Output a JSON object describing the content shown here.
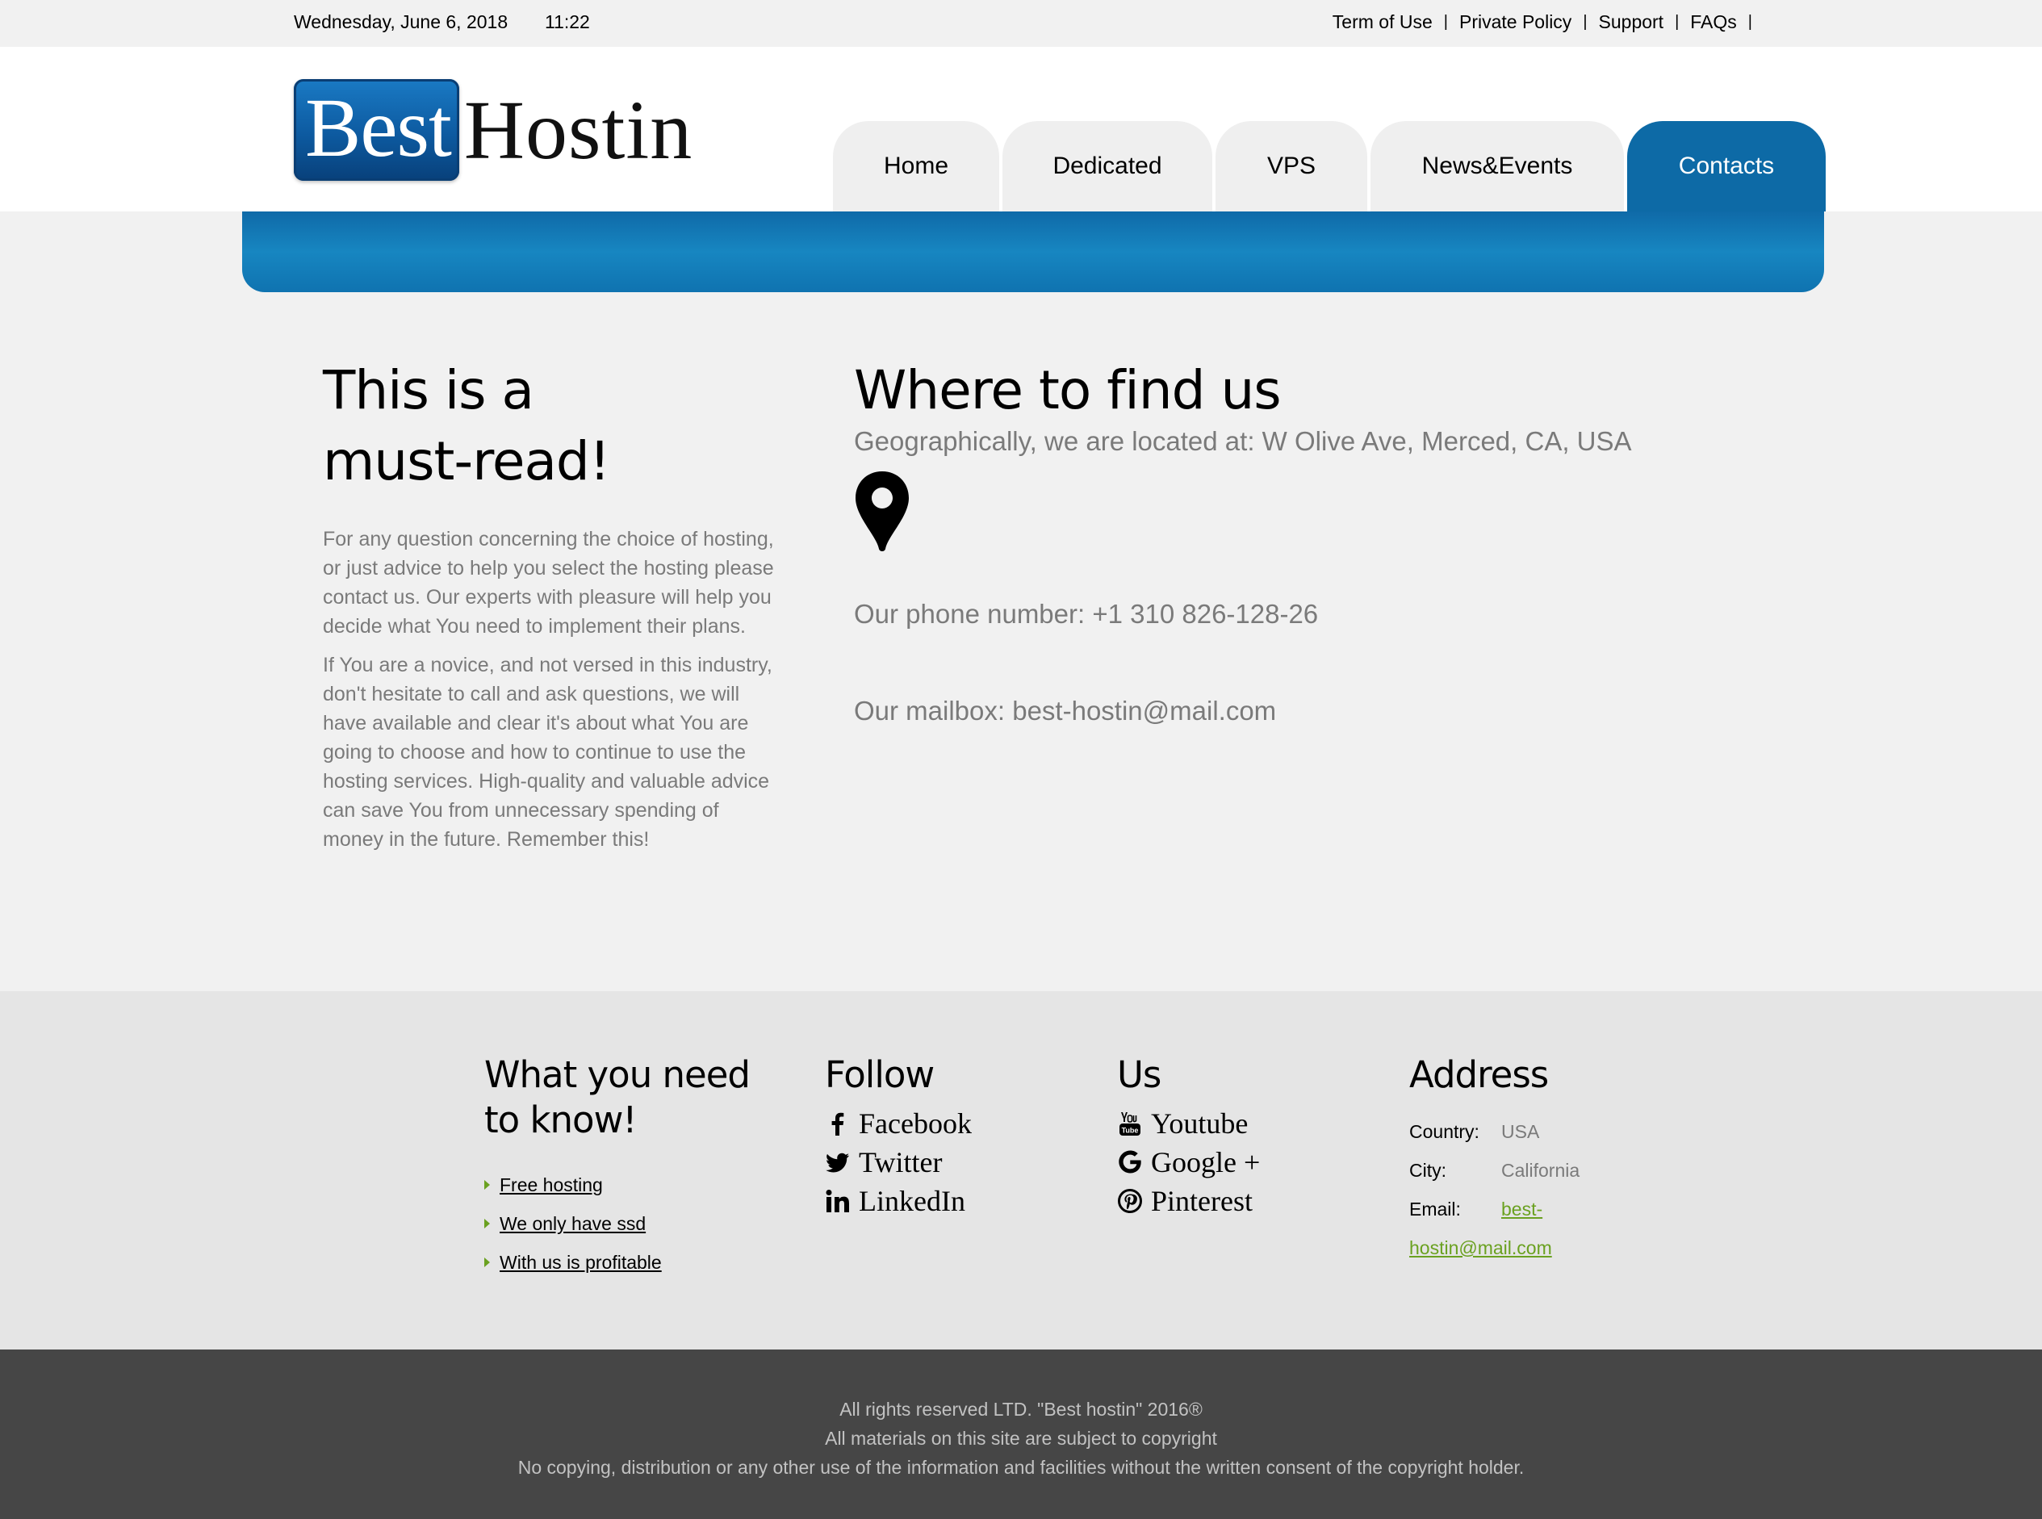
{
  "topbar": {
    "date": "Wednesday, June 6, 2018",
    "time": "11:22",
    "links": [
      "Term of Use",
      "Private Policy",
      "Support",
      "FAQs"
    ],
    "separator": "|"
  },
  "logo": {
    "part1": "Best",
    "part2": "Hostin"
  },
  "nav": {
    "tabs": [
      {
        "label": "Home"
      },
      {
        "label": "Dedicated"
      },
      {
        "label": "VPS"
      },
      {
        "label": "News&Events"
      },
      {
        "label": "Contacts"
      }
    ],
    "active_index": 4,
    "active_color": "#0d6aa6"
  },
  "main": {
    "left_heading_line1": "This is a",
    "left_heading_line2": "must-read!",
    "para1": "For any question concerning the choice of hosting, or just advice to help you select the hosting please contact us. Our experts with pleasure will help you decide what You need to implement their plans.",
    "para2": "If You are a novice, and not versed in this industry, don't hesitate to call and ask questions, we will have available and clear it's about what You are going to choose and how to continue to use the hosting services. High-quality and valuable advice can save You from unnecessary spending of money in the future. Remember this!",
    "right_heading": "Where to find us",
    "location": "Geographically, we are located at: W Olive Ave, Merced, CA, USA",
    "phone": "Our phone number: +1 310 826-128-26",
    "mailbox": "Our mailbox: best-hostin@mail.com",
    "pin_icon": "map-pin-icon"
  },
  "footer": {
    "col1": {
      "heading_line1": "What you need",
      "heading_line2": "to know!",
      "links": [
        "Free hosting",
        "We only have ssd",
        "With us is profitable"
      ]
    },
    "col2": {
      "heading": "Follow",
      "items": [
        {
          "label": "Facebook",
          "icon": "facebook-icon"
        },
        {
          "label": "Twitter",
          "icon": "twitter-icon"
        },
        {
          "label": "LinkedIn",
          "icon": "linkedin-icon"
        }
      ]
    },
    "col3": {
      "heading": "Us",
      "items": [
        {
          "label": "Youtube",
          "icon": "youtube-icon"
        },
        {
          "label": "Google +",
          "icon": "google-icon"
        },
        {
          "label": "Pinterest",
          "icon": "pinterest-icon"
        }
      ]
    },
    "col4": {
      "heading": "Address",
      "country_label": "Country:",
      "country": "USA",
      "city_label": "City:",
      "city": "California",
      "email_label": "Email:",
      "email_part1": "best-",
      "email_part2": "hostin@mail.com",
      "link_color": "#6aa120"
    }
  },
  "bottom": {
    "line1": "All rights reserved LTD. \"Best hostin\" 2016®",
    "line2": "All materials on this site are subject to copyright",
    "line3": "No copying, distribution or any other use of the information and facilities without the written consent of the copyright holder."
  }
}
